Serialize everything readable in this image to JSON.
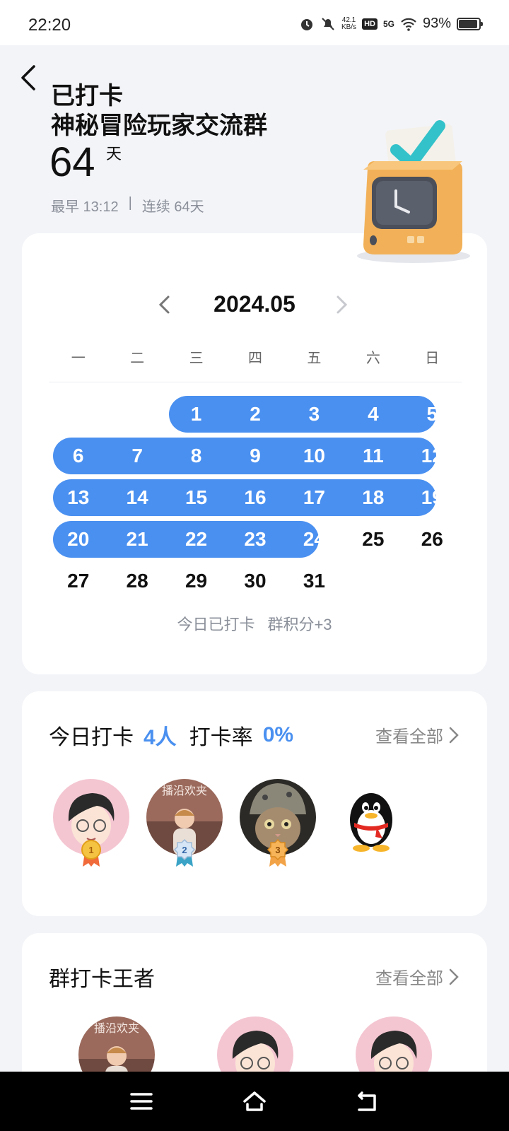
{
  "status_bar": {
    "time": "22:20",
    "net_speed_value": "42.1",
    "net_speed_unit": "KB/s",
    "hd": "HD",
    "signal": "5G",
    "battery": "93%"
  },
  "header": {
    "title": "已打卡",
    "group_name": "神秘冒险玩家交流群",
    "days": "64",
    "days_unit": "天",
    "earliest": "最早 13:12",
    "separator": "|",
    "streak": "连续 64天"
  },
  "calendar": {
    "month": "2024.05",
    "weekdays": [
      "一",
      "二",
      "三",
      "四",
      "五",
      "六",
      "日"
    ],
    "footer_status": "今日已打卡",
    "footer_points": "群积分+3"
  },
  "today": {
    "label_checkin": "今日打卡",
    "count": "4人",
    "label_rate": "打卡率",
    "rate": "0%",
    "see_all": "查看全部",
    "medals": [
      "1",
      "2",
      "3"
    ]
  },
  "king": {
    "title": "群打卡王者",
    "see_all": "查看全部"
  },
  "colors": {
    "accent": "#4a90f0"
  }
}
